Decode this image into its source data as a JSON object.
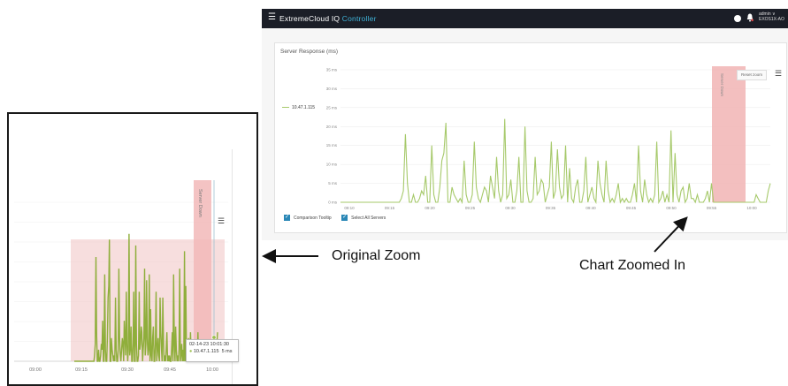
{
  "app": {
    "brand_main": "ExtremeCloud IQ",
    "brand_accent": "Controller",
    "user_line1": "admin ∨",
    "user_line2": "EXOS1X-AO",
    "colors": {
      "topbar": "#1b1e27",
      "accent": "#3fb1d6",
      "series": "#a6c96a",
      "maintenance_band": "#f2b8b8",
      "checkbox": "#2a87b6"
    }
  },
  "chart": {
    "title": "Server Response (ms)",
    "legend_label": "10.47.1.115",
    "reset_zoom_label": "Reset zoom",
    "band_label": "Server Down",
    "checkboxes": [
      {
        "label": "Comparison Tooltip",
        "checked": true
      },
      {
        "label": "Select All Servers",
        "checked": true
      }
    ]
  },
  "chart_data": {
    "type": "line",
    "series": [
      {
        "name": "10.47.1.115",
        "values": [
          0,
          0,
          0,
          0,
          0,
          0,
          0,
          0,
          0,
          0,
          0,
          0,
          0,
          0,
          0,
          0,
          0,
          0,
          0,
          0,
          0,
          0,
          0,
          0,
          0,
          0,
          0,
          0,
          0,
          0,
          1,
          3,
          18,
          5,
          0,
          0,
          2,
          0,
          0,
          1,
          3,
          2,
          7,
          0,
          0,
          15,
          2,
          0,
          0,
          4,
          11,
          13,
          21,
          0,
          0,
          4,
          2,
          1,
          0,
          1,
          0,
          11,
          2,
          0,
          0,
          2,
          16,
          4,
          1,
          0,
          2,
          4,
          3,
          0,
          7,
          4,
          1,
          12,
          3,
          0,
          2,
          22,
          1,
          2,
          6,
          0,
          0,
          3,
          12,
          0,
          0,
          20,
          3,
          0,
          0,
          1,
          12,
          2,
          3,
          6,
          5,
          0,
          2,
          4,
          16,
          1,
          3,
          14,
          4,
          1,
          2,
          15,
          0,
          9,
          1,
          0,
          4,
          6,
          0,
          0,
          3,
          12,
          0,
          2,
          4,
          1,
          0,
          11,
          5,
          2,
          0,
          11,
          3,
          0,
          1,
          0,
          2,
          5,
          0,
          1,
          0,
          1,
          0,
          0,
          2,
          5,
          0,
          15,
          3,
          0,
          6,
          2,
          0,
          1,
          0,
          2,
          16,
          0,
          1,
          3,
          0,
          2,
          0,
          19,
          0,
          13,
          2,
          0,
          3,
          4,
          0,
          1,
          5,
          1,
          1,
          0,
          2,
          0,
          0,
          0,
          1,
          3,
          0,
          5,
          0,
          0,
          0,
          0,
          0,
          0,
          0,
          0,
          0,
          0,
          0,
          0,
          0,
          0,
          0,
          0,
          0,
          0,
          0,
          0,
          0,
          2,
          1,
          0,
          0,
          0,
          0,
          3,
          5
        ]
      }
    ],
    "x_tick_labels": [
      "09:10",
      "09:15",
      "09:20",
      "09:25",
      "09:30",
      "09:35",
      "09:40",
      "09:45",
      "09:50",
      "09:55",
      "10:00",
      "10:05"
    ],
    "y_tick_labels": [
      "0 ms",
      "5 ms",
      "10 ms",
      "15 ms",
      "20 ms",
      "25 ms",
      "30 ms",
      "35 ms"
    ],
    "ylim": [
      0,
      35
    ],
    "grid": true,
    "annotation": "Server Down"
  },
  "original_zoom": {
    "x_tick_labels": [
      "09:00",
      "09:15",
      "09:30",
      "09:45",
      "10:00"
    ],
    "band_label": "Server Down",
    "tooltip_line1": "02-14-23 10:01:30",
    "tooltip_series": "10.47.1.115",
    "tooltip_value": "5 ms"
  },
  "callouts": {
    "original": "Original Zoom",
    "zoomed": "Chart Zoomed In"
  }
}
